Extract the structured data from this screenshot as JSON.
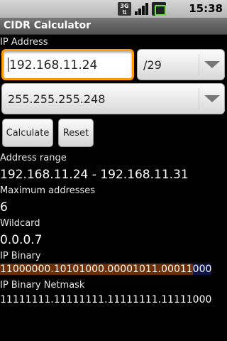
{
  "status_bar": {
    "network": "3G",
    "time": "15:38",
    "icons": [
      "3g-icon",
      "signal-icon",
      "battery-icon"
    ]
  },
  "app": {
    "title": "CIDR Calculator"
  },
  "ip_section": {
    "label": "IP Address",
    "ip_value": "192.168.11.24",
    "cidr_value": "/29",
    "netmask_value": "255.255.255.248"
  },
  "buttons": {
    "calculate": "Calculate",
    "reset": "Reset"
  },
  "results": {
    "address_range_label": "Address range",
    "address_range_value": "192.168.11.24 - 192.168.11.31",
    "max_addresses_label": "Maximum addresses",
    "max_addresses_value": "6",
    "wildcard_label": "Wildcard",
    "wildcard_value": "0.0.0.7",
    "ip_binary_label": "IP Binary",
    "ip_binary_network": "11000000.10101000.00001011.00011",
    "ip_binary_host": "000",
    "ip_binary_netmask_label": "IP Binary Netmask",
    "ip_binary_netmask_value": "11111111.11111111.11111111.11111000"
  },
  "colors": {
    "input_focus_border": "#ff9a00",
    "binary_network_highlight": "#6b2e06",
    "binary_host_highlight": "#0c1348"
  }
}
